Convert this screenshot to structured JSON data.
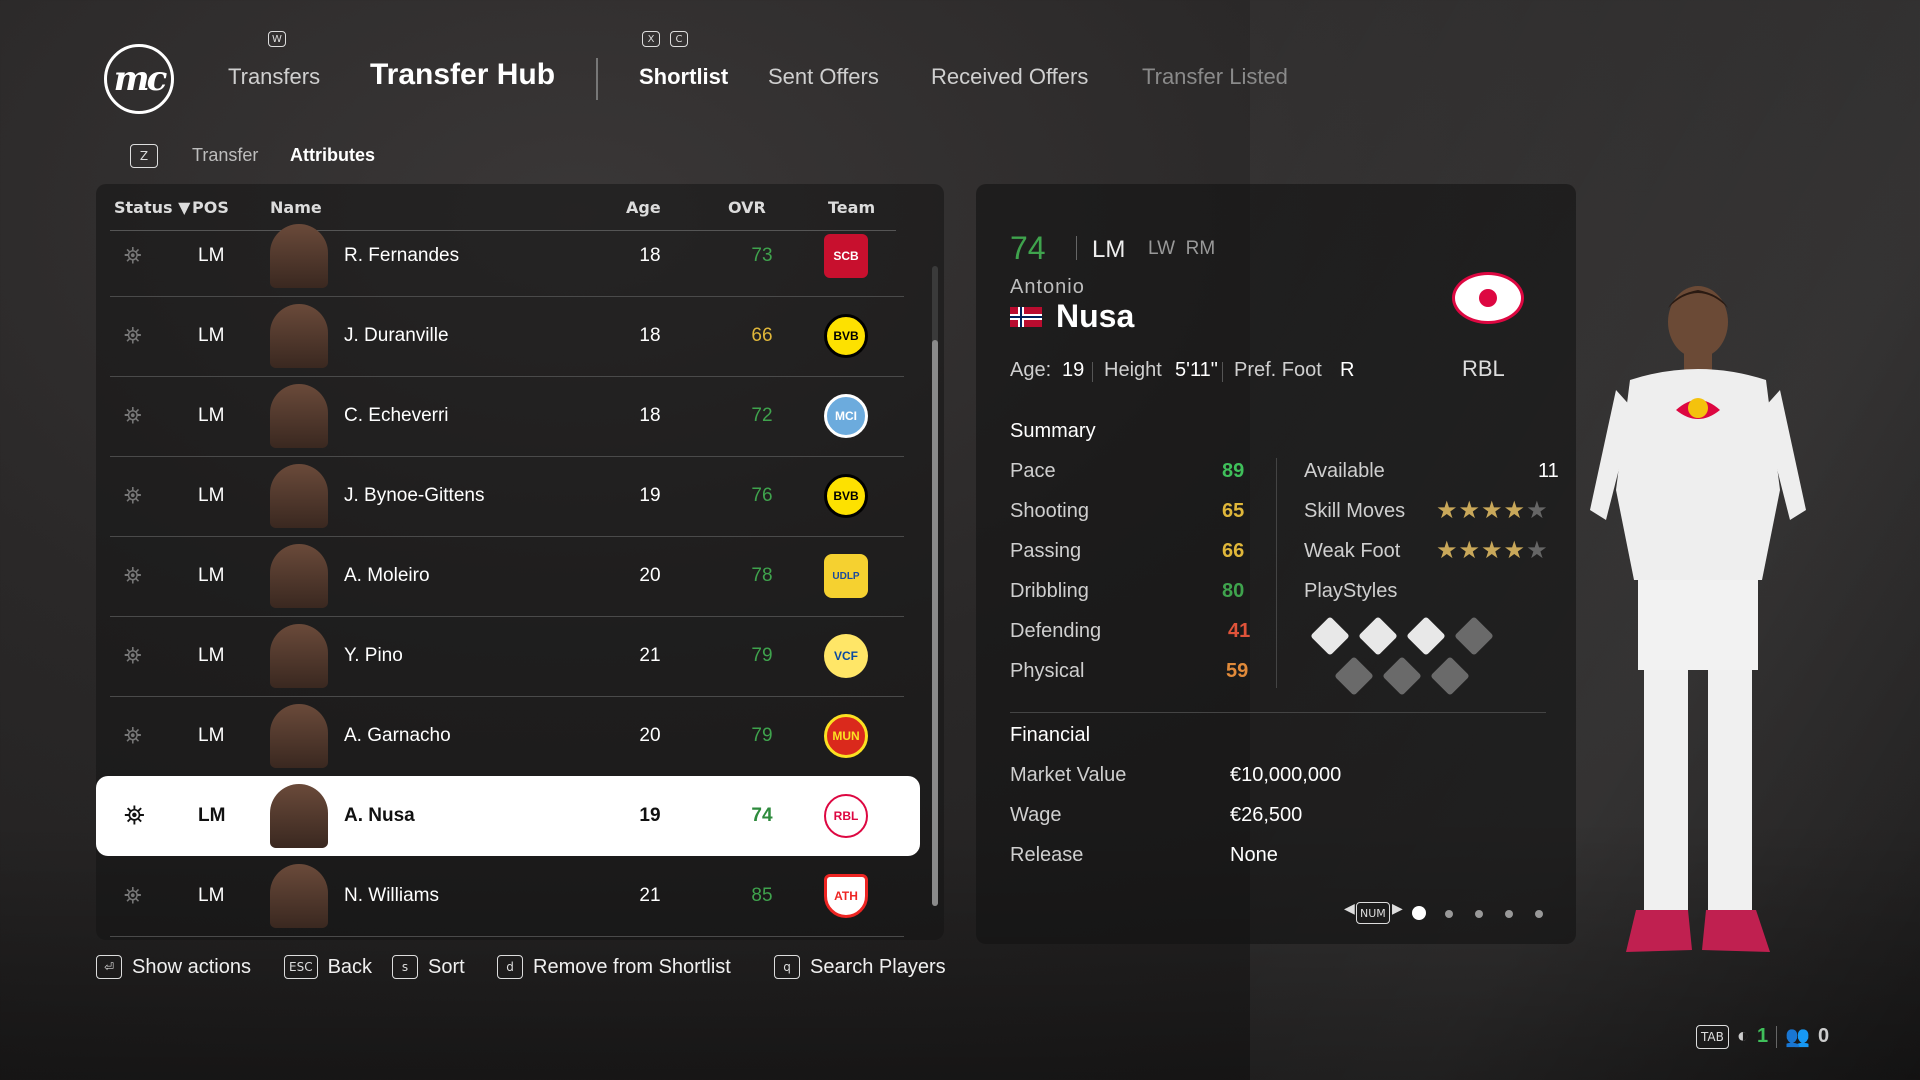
{
  "nav": {
    "logo": "mc",
    "transfers": "Transfers",
    "title": "Transfer Hub",
    "tabs": [
      "Shortlist",
      "Sent Offers",
      "Received Offers",
      "Transfer Listed"
    ],
    "key_w": "W",
    "key_x": "X",
    "key_c": "C"
  },
  "breadcrumb": {
    "key": "Z",
    "transfer": "Transfer",
    "attributes": "Attributes"
  },
  "table": {
    "headers": {
      "status": "Status ▼",
      "pos": "POS",
      "name": "Name",
      "age": "Age",
      "ovr": "OVR",
      "team": "Team"
    },
    "rows": [
      {
        "pos": "LM",
        "name": "R. Fernandes",
        "age": "18",
        "ovr": "73",
        "ovr_color": "#3fa34d",
        "crest": "SCB",
        "crest_color": "#c8102e"
      },
      {
        "pos": "LM",
        "name": "J. Duranville",
        "age": "18",
        "ovr": "66",
        "ovr_color": "#e0b73a",
        "crest": "BVB",
        "crest_color": "#fde100"
      },
      {
        "pos": "LM",
        "name": "C. Echeverri",
        "age": "18",
        "ovr": "72",
        "ovr_color": "#3fa34d",
        "crest": "MCI",
        "crest_color": "#6cabdd"
      },
      {
        "pos": "LM",
        "name": "J. Bynoe-Gittens",
        "age": "19",
        "ovr": "76",
        "ovr_color": "#3fa34d",
        "crest": "BVB",
        "crest_color": "#fde100"
      },
      {
        "pos": "LM",
        "name": "A. Moleiro",
        "age": "20",
        "ovr": "78",
        "ovr_color": "#3fa34d",
        "crest": "UDLP",
        "crest_color": "#f5d130"
      },
      {
        "pos": "LM",
        "name": "Y. Pino",
        "age": "21",
        "ovr": "79",
        "ovr_color": "#3fa34d",
        "crest": "VCF",
        "crest_color": "#ffe667"
      },
      {
        "pos": "LM",
        "name": "A. Garnacho",
        "age": "20",
        "ovr": "79",
        "ovr_color": "#3fa34d",
        "crest": "MUN",
        "crest_color": "#da291c"
      },
      {
        "pos": "LM",
        "name": "A. Nusa",
        "age": "19",
        "ovr": "74",
        "ovr_color": "#2e8b3d",
        "crest": "RBL",
        "crest_color": "#dd0741"
      },
      {
        "pos": "LM",
        "name": "N. Williams",
        "age": "21",
        "ovr": "85",
        "ovr_color": "#3fa34d",
        "crest": "ATH",
        "crest_color": "#ee2523"
      }
    ]
  },
  "player": {
    "ovr": "74",
    "pos": "LM",
    "alt_pos": "LW  RM",
    "first_name": "Antonio",
    "last_name": "Nusa",
    "age_label": "Age:",
    "age": "19",
    "height_label": "Height",
    "height": "5'11\"",
    "foot_label": "Pref. Foot",
    "foot": "R",
    "club": "RBL",
    "summary_title": "Summary",
    "stats": [
      {
        "label": "Pace",
        "value": "89",
        "color": "#3fbf5a"
      },
      {
        "label": "Shooting",
        "value": "65",
        "color": "#e0b73a"
      },
      {
        "label": "Passing",
        "value": "66",
        "color": "#e0b73a"
      },
      {
        "label": "Dribbling",
        "value": "80",
        "color": "#3fa34d"
      },
      {
        "label": "Defending",
        "value": "41",
        "color": "#e0533a"
      },
      {
        "label": "Physical",
        "value": "59",
        "color": "#e08a3a"
      }
    ],
    "available_label": "Available",
    "available": "11",
    "skill_label": "Skill Moves",
    "skill_stars": 4,
    "weak_label": "Weak Foot",
    "weak_stars": 4,
    "playstyles_label": "PlayStyles",
    "financial_title": "Financial",
    "market_label": "Market Value",
    "market": "€10,000,000",
    "wage_label": "Wage",
    "wage": "€26,500",
    "release_label": "Release",
    "release": "None",
    "pager_key": "NUM"
  },
  "footer": {
    "show_actions": "Show actions",
    "back_key": "ESC",
    "back": "Back",
    "sort_key": "s",
    "sort": "Sort",
    "remove_key": "d",
    "remove": "Remove from Shortlist",
    "search_key": "q",
    "search": "Search Players",
    "tab_key": "TAB",
    "count1": "1",
    "count2": "0"
  }
}
